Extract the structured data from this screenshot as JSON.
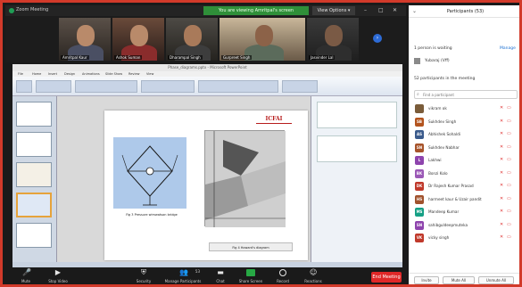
{
  "window": {
    "title": "Zoom Meeting",
    "share_banner": "You are viewing Amritpal's screen",
    "view_options": "View Options ▾",
    "controls": [
      "–",
      "□",
      "✕"
    ]
  },
  "video_strip": {
    "tiles": [
      {
        "name": "Amritpal Kaur"
      },
      {
        "name": "Ashok Suman"
      },
      {
        "name": "Dharampal Singh"
      },
      {
        "name": "Gurpreet Singh"
      },
      {
        "name": "Jasvinder Lal"
      }
    ],
    "next_icon": "arrow-right"
  },
  "presentation": {
    "window_title": "Phase_diagrams.pptx - Microsoft PowerPoint",
    "menu": [
      "File",
      "Home",
      "Insert",
      "Design",
      "Animations",
      "Slide Show",
      "Review",
      "View"
    ],
    "logo_text": "ICFAI",
    "figure1_caption": "Fig 3 Pressure wimwatson bridge",
    "figure2_caption": "Fig 4 Howard's diagram"
  },
  "toolbar": {
    "buttons": [
      {
        "label": "Mute"
      },
      {
        "label": "Stop Video"
      },
      {
        "label": "Security"
      },
      {
        "label": "Manage Participants",
        "count": "53"
      },
      {
        "label": "Chat"
      },
      {
        "label": "Share Screen"
      },
      {
        "label": "Record"
      },
      {
        "label": "Reactions"
      }
    ],
    "end_label": "End Meeting"
  },
  "participants_panel": {
    "title": "Participants (53)",
    "waiting_text": "1 person is waiting",
    "manage_label": "Manage",
    "waiting_person": "Yubaraj (Vff)",
    "in_meeting_text": "52 participants in the meeting",
    "search_placeholder": "Find a participant",
    "participants": [
      {
        "initials": "",
        "name": "vikram ok",
        "color": "#7a5c3a"
      },
      {
        "initials": "SB",
        "name": "Sukhdev Singh",
        "color": "#b3541e"
      },
      {
        "initials": "AS",
        "name": "Abhishek Sohaldi",
        "color": "#3b5b8c"
      },
      {
        "initials": "SN",
        "name": "Sukhdev Nabhar",
        "color": "#a7542b"
      },
      {
        "initials": "L",
        "name": "Lakhwi",
        "color": "#8e44ad"
      },
      {
        "initials": "BK",
        "name": "Bonzi Kolo",
        "color": "#9b59b6"
      },
      {
        "initials": "DK",
        "name": "Dr Rajesh Kumar Prasad",
        "color": "#c0392b"
      },
      {
        "initials": "HS",
        "name": "harmeet kaur & Uzair pandit",
        "color": "#a0522d"
      },
      {
        "initials": "MS",
        "name": "Mandeep Kumar",
        "color": "#16a085"
      },
      {
        "initials": "SN",
        "name": "sahibguldeepmuteka",
        "color": "#8e44ad"
      },
      {
        "initials": "VK",
        "name": "vicky singh",
        "color": "#c0392b"
      }
    ],
    "footer_buttons": [
      "Invite",
      "Mute All",
      "Unmute All"
    ]
  }
}
